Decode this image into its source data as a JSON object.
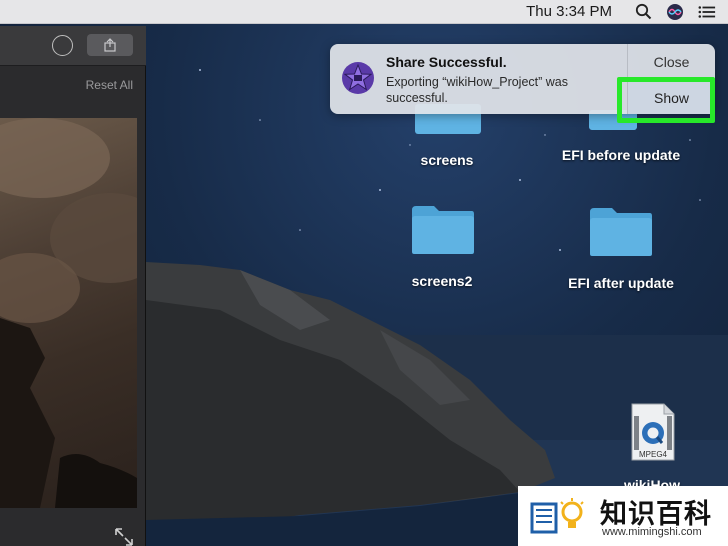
{
  "menubar": {
    "clock": "Thu 3:34 PM",
    "icons": [
      "search-icon",
      "siri-icon",
      "notification-center-icon"
    ]
  },
  "app_window": {
    "reset_label": "Reset All",
    "toolbar_icons": [
      "circle-icon",
      "share-icon"
    ],
    "expand_icon": "expand-icon"
  },
  "notification": {
    "title": "Share Successful.",
    "body": "Exporting “wikiHow_Project” was successful.",
    "close_label": "Close",
    "show_label": "Show",
    "app_icon": "imovie-star-icon",
    "highlight_color": "#27e82a"
  },
  "desktop": {
    "items": [
      {
        "label": "screens",
        "type": "folder"
      },
      {
        "label": "EFI before update",
        "type": "folder"
      },
      {
        "label": "screens2",
        "type": "folder"
      },
      {
        "label": "EFI after update",
        "type": "folder"
      },
      {
        "label": "wikiHow",
        "type": "mpeg4-file",
        "badge": "MPEG4"
      }
    ]
  },
  "watermark": {
    "text_cn": "知识百科",
    "url": "www.mimingshi.com"
  },
  "colors": {
    "folder": "#5fb3e3",
    "folder_tab": "#4da3d6",
    "menubar": "#e6e6e8"
  }
}
